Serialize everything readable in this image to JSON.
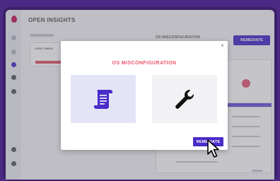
{
  "app": {
    "title": "OPEN INSIGHTS"
  },
  "background_panel": {
    "title": "OS MISCONFIGURATION",
    "remediate_label": "REMEDIATE",
    "row_label": "OPEN THREAT"
  },
  "modal": {
    "title": "OS MISCONFIGURATION",
    "close_symbol": "x",
    "remediate_label": "REMEDIATE",
    "tiles": [
      {
        "icon": "scroll-document-icon"
      },
      {
        "icon": "wrench-icon"
      }
    ]
  },
  "colors": {
    "accent": "#4a2cc9",
    "title_red": "#ea5568",
    "frame_purple": "#4b2a86",
    "doc_icon": "#4a2cc9"
  }
}
